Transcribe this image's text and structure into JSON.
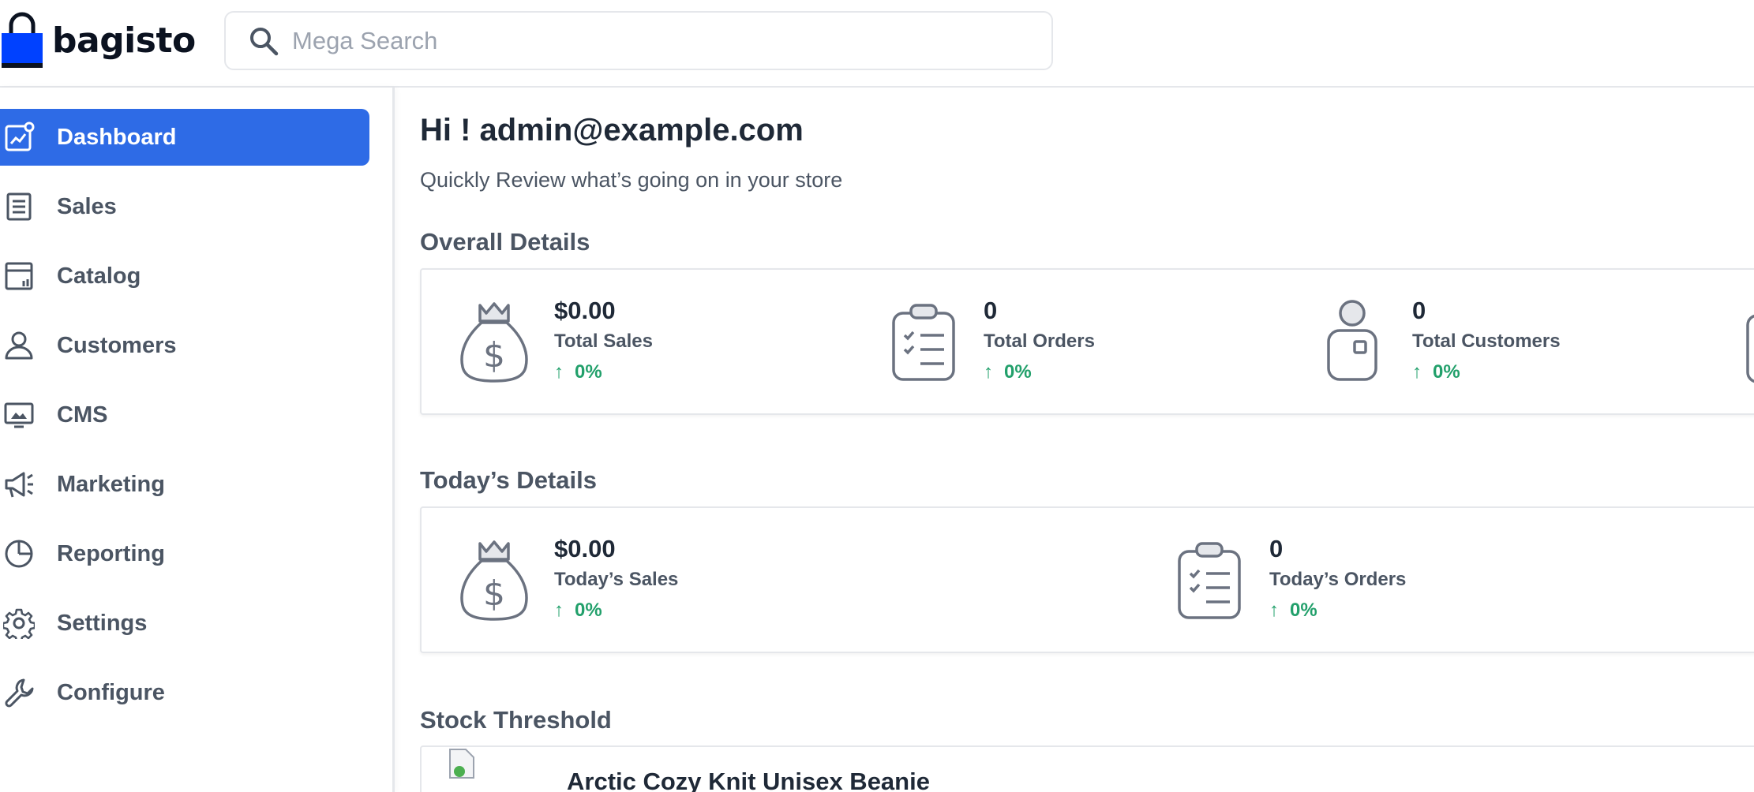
{
  "header": {
    "logo_text": "bagisto",
    "search_placeholder": "Mega Search"
  },
  "sidebar": {
    "items": [
      {
        "label": "Dashboard",
        "icon": "dashboard-icon",
        "active": true
      },
      {
        "label": "Sales",
        "icon": "sales-icon"
      },
      {
        "label": "Catalog",
        "icon": "catalog-icon"
      },
      {
        "label": "Customers",
        "icon": "customers-icon"
      },
      {
        "label": "CMS",
        "icon": "cms-icon"
      },
      {
        "label": "Marketing",
        "icon": "marketing-icon"
      },
      {
        "label": "Reporting",
        "icon": "reporting-icon"
      },
      {
        "label": "Settings",
        "icon": "settings-icon"
      },
      {
        "label": "Configure",
        "icon": "configure-icon"
      }
    ]
  },
  "main": {
    "greeting": "Hi ! admin@example.com",
    "subtitle": "Quickly Review what’s going on in your store",
    "overall": {
      "title": "Overall Details",
      "stats": [
        {
          "value": "$0.00",
          "label": "Total Sales",
          "change": "0%",
          "icon": "money-bag-icon"
        },
        {
          "value": "0",
          "label": "Total Orders",
          "change": "0%",
          "icon": "clipboard-checklist-icon"
        },
        {
          "value": "0",
          "label": "Total Customers",
          "change": "0%",
          "icon": "customer-person-icon"
        }
      ]
    },
    "today": {
      "title": "Today’s Details",
      "stats": [
        {
          "value": "$0.00",
          "label": "Today’s Sales",
          "change": "0%",
          "icon": "money-bag-icon"
        },
        {
          "value": "0",
          "label": "Today’s Orders",
          "change": "0%",
          "icon": "clipboard-checklist-icon"
        }
      ]
    },
    "stock": {
      "title": "Stock Threshold",
      "items": [
        {
          "name": "Arctic Cozy Knit Unisex Beanie"
        }
      ]
    }
  },
  "colors": {
    "accent": "#2e6be6",
    "positive": "#22a06b",
    "logo_blue": "#0041ff"
  }
}
